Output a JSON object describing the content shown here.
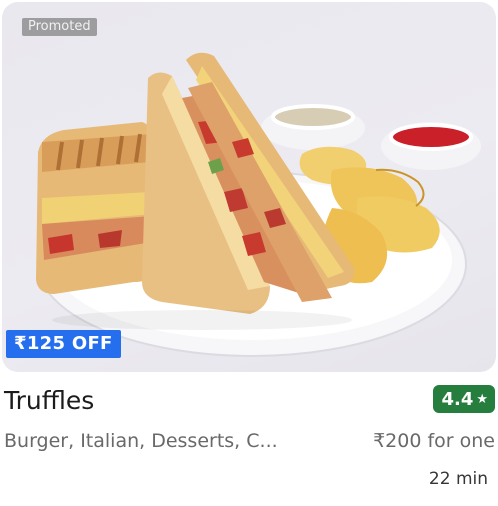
{
  "card": {
    "promoted_label": "Promoted",
    "offer_label": "₹125 OFF",
    "restaurant_name": "Truffles",
    "rating": "4.4",
    "rating_icon": "star-icon",
    "cuisines": "Burger, Italian, Desserts, C...",
    "price_for_one": "₹200 for one",
    "delivery_time": "22 min",
    "food_image": "food-photo-sandwich"
  },
  "colors": {
    "offer_badge_bg": "#256fef",
    "rating_badge_bg": "#267e3e",
    "text_primary": "#1c1c1c",
    "text_secondary": "#696969"
  }
}
